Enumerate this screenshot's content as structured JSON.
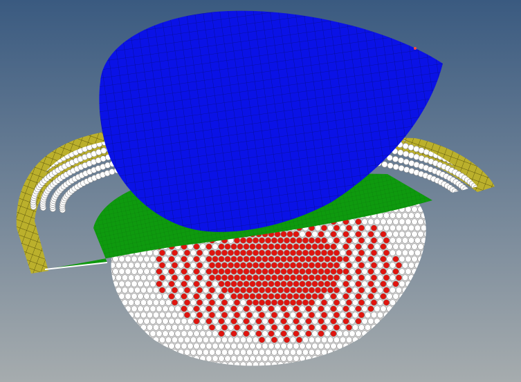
{
  "viewport": {
    "background_top": "#3a5a80",
    "background_bottom": "#a6acae"
  },
  "scene": {
    "parts": [
      {
        "name": "punch",
        "color": "#0a12e6",
        "mesh_line": "#050a60"
      },
      {
        "name": "blank",
        "color": "#0e9a0e",
        "mesh_line": "#0a5a0a"
      },
      {
        "name": "binder-ring",
        "color": "#bbb02c",
        "mesh_line": "#3a3500"
      },
      {
        "name": "die-spheres",
        "color": "#ffffff",
        "contact_color": "#e0140e"
      }
    ]
  }
}
